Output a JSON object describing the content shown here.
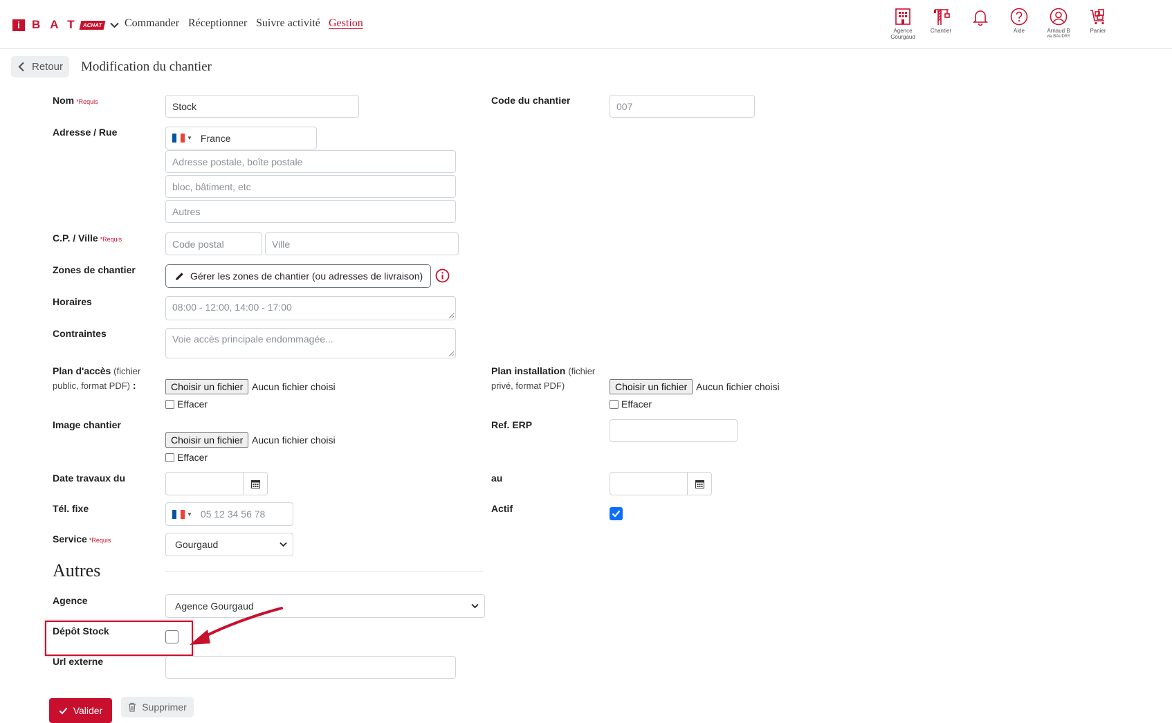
{
  "nav": {
    "logo_letter": "i",
    "logo_text": "BAT",
    "logo_badge": "ACHAT",
    "links": [
      "Commander",
      "Réceptionner",
      "Suivre activité",
      "Gestion"
    ],
    "icons": [
      {
        "icon": "building-icon",
        "label1": "Agence",
        "label2": "Gourgaud"
      },
      {
        "icon": "crane-icon",
        "label1": "Chantier",
        "label2": ""
      },
      {
        "icon": "bell-icon",
        "label1": "",
        "label2": ""
      },
      {
        "icon": "help-icon",
        "label1": "Aide",
        "label2": ""
      },
      {
        "icon": "user-icon",
        "label1": "Arnaud B",
        "label2": "via BAUDRY"
      },
      {
        "icon": "cart-icon",
        "label1": "Panier",
        "label2": ""
      }
    ]
  },
  "header": {
    "back_label": "Retour",
    "title": "Modification du chantier"
  },
  "form": {
    "nom": {
      "label": "Nom",
      "required": "*Requis",
      "value": "Stock"
    },
    "code": {
      "label": "Code du chantier",
      "value": "007"
    },
    "adresse": {
      "label": "Adresse / Rue",
      "country": "France",
      "line1_placeholder": "Adresse postale, boîte postale",
      "line2_placeholder": "bloc, bâtiment, etc",
      "line3_placeholder": "Autres"
    },
    "cp": {
      "label": "C.P. / Ville",
      "required": "*Requis",
      "cp_placeholder": "Code postal",
      "ville_placeholder": "Ville"
    },
    "zones": {
      "label": "Zones de chantier",
      "button": "Gérer les zones de chantier (ou adresses de livraison)"
    },
    "horaires": {
      "label": "Horaires",
      "placeholder": "08:00 - 12:00, 14:00 - 17:00"
    },
    "contraintes": {
      "label": "Contraintes",
      "placeholder": "Voie accès principale endommagée..."
    },
    "plan_acces": {
      "label": "Plan d'accès",
      "hint1": "(fichier",
      "hint2": "public, format PDF)",
      "colon": ":",
      "button": "Choisir un fichier",
      "status": "Aucun fichier choisi",
      "clear": "Effacer"
    },
    "plan_install": {
      "label": "Plan installation",
      "hint1": "(fichier",
      "hint2": "privé, format PDF)",
      "button": "Choisir un fichier",
      "status": "Aucun fichier choisi",
      "clear": "Effacer"
    },
    "image": {
      "label": "Image chantier",
      "button": "Choisir un fichier",
      "status": "Aucun fichier choisi",
      "clear": "Effacer"
    },
    "ref_erp": {
      "label": "Ref. ERP",
      "value": ""
    },
    "date_du": {
      "label": "Date travaux du",
      "value": ""
    },
    "date_au": {
      "label": "au",
      "value": ""
    },
    "tel": {
      "label": "Tél. fixe",
      "placeholder": "05 12 34 56 78"
    },
    "actif": {
      "label": "Actif",
      "checked": true
    },
    "service": {
      "label": "Service",
      "required": "*Requis",
      "value": "Gourgaud"
    },
    "autres_title": "Autres",
    "agence": {
      "label": "Agence",
      "value": "Agence Gourgaud"
    },
    "depot": {
      "label": "Dépôt Stock",
      "checked": false
    },
    "url": {
      "label": "Url externe",
      "value": ""
    }
  },
  "actions": {
    "valider": "Valider",
    "supprimer": "Supprimer"
  },
  "colors": {
    "brand": "#c8102e",
    "check": "#0d6efd"
  }
}
